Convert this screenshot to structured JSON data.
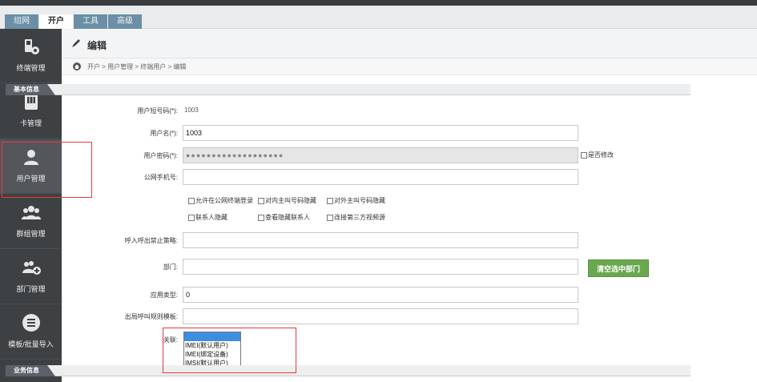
{
  "tabs": [
    {
      "label": "组网",
      "active": false
    },
    {
      "label": "开户",
      "active": true
    },
    {
      "label": "工具",
      "active": false
    },
    {
      "label": "高级",
      "active": false
    }
  ],
  "sidebar": {
    "items": [
      {
        "label": "终端管理",
        "icon": "terminal-settings-icon"
      },
      {
        "label": "卡管理",
        "icon": "sim-card-icon"
      },
      {
        "label": "用户管理",
        "icon": "user-icon",
        "active": true
      },
      {
        "label": "群组管理",
        "icon": "group-icon"
      },
      {
        "label": "部门管理",
        "icon": "department-add-icon"
      },
      {
        "label": "模板/批量导入",
        "icon": "template-import-icon"
      }
    ]
  },
  "header": {
    "title": "编辑",
    "icon": "pen-icon"
  },
  "breadcrumb": {
    "text": "开户 > 用户管理 > 终端用户 > 编辑"
  },
  "sections": {
    "basic": "基本信息",
    "business": "业务信息"
  },
  "form": {
    "short_code_label": "用户短号码(*):",
    "short_code_value": "1003",
    "username_label": "用户名(*):",
    "username_value": "1003",
    "password_label": "用户密码(*):",
    "password_value": "●●●●●●●●●●●●●●●●●●●",
    "modify_checkbox": "是否修改",
    "phone_label": "公网手机号:",
    "phone_value": "",
    "options_row1": [
      "允许在公网终端登录",
      "对内主叫号码隐藏",
      "对外主叫号码隐藏"
    ],
    "options_row2": [
      "联系人隐藏",
      "查看隐藏联系人",
      "连接第三方视频源"
    ],
    "call_ban_label": "呼入呼出禁止策略:",
    "call_ban_value": "",
    "dept_label": "部门:",
    "dept_value": "",
    "clear_dept_button": "清空选中部门",
    "app_type_label": "应用类型:",
    "app_type_value": "0",
    "outbound_rule_label": "出局呼叫规则模板:",
    "outbound_rule_value": "",
    "assoc_label": "关联:",
    "assoc_options": [
      "",
      "IMEI(默认用户)",
      "IMEI(绑定设备)",
      "IMSI(默认用户)"
    ],
    "assoc_selected_index": 0
  },
  "colors": {
    "accent_green": "#6aa84f",
    "highlight_red": "#e23c3c",
    "sidebar_bg": "#3e4144",
    "tab_blue": "#6b8fa6"
  }
}
